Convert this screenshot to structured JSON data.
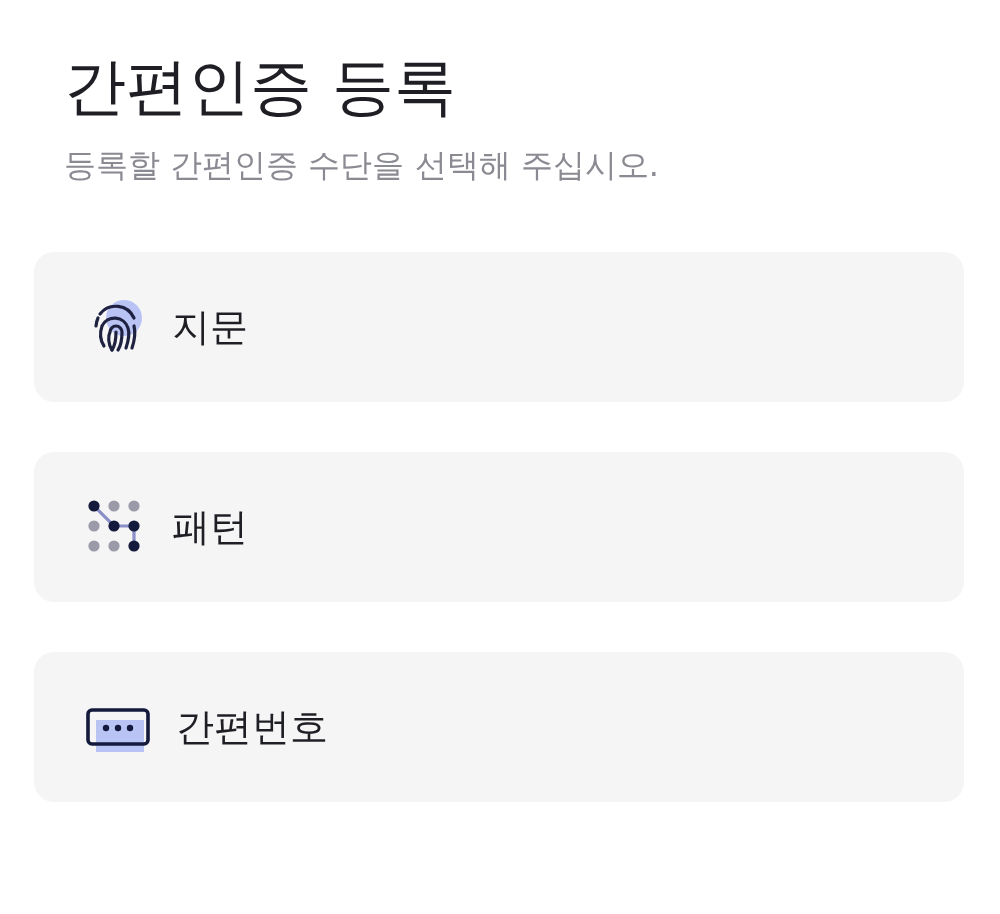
{
  "title": "간편인증 등록",
  "subtitle": "등록할 간편인증 수단을 선택해 주십시오.",
  "options": [
    {
      "kind": "fingerprint",
      "label": "지문"
    },
    {
      "kind": "pattern",
      "label": "패턴"
    },
    {
      "kind": "pin",
      "label": "간편번호"
    }
  ]
}
